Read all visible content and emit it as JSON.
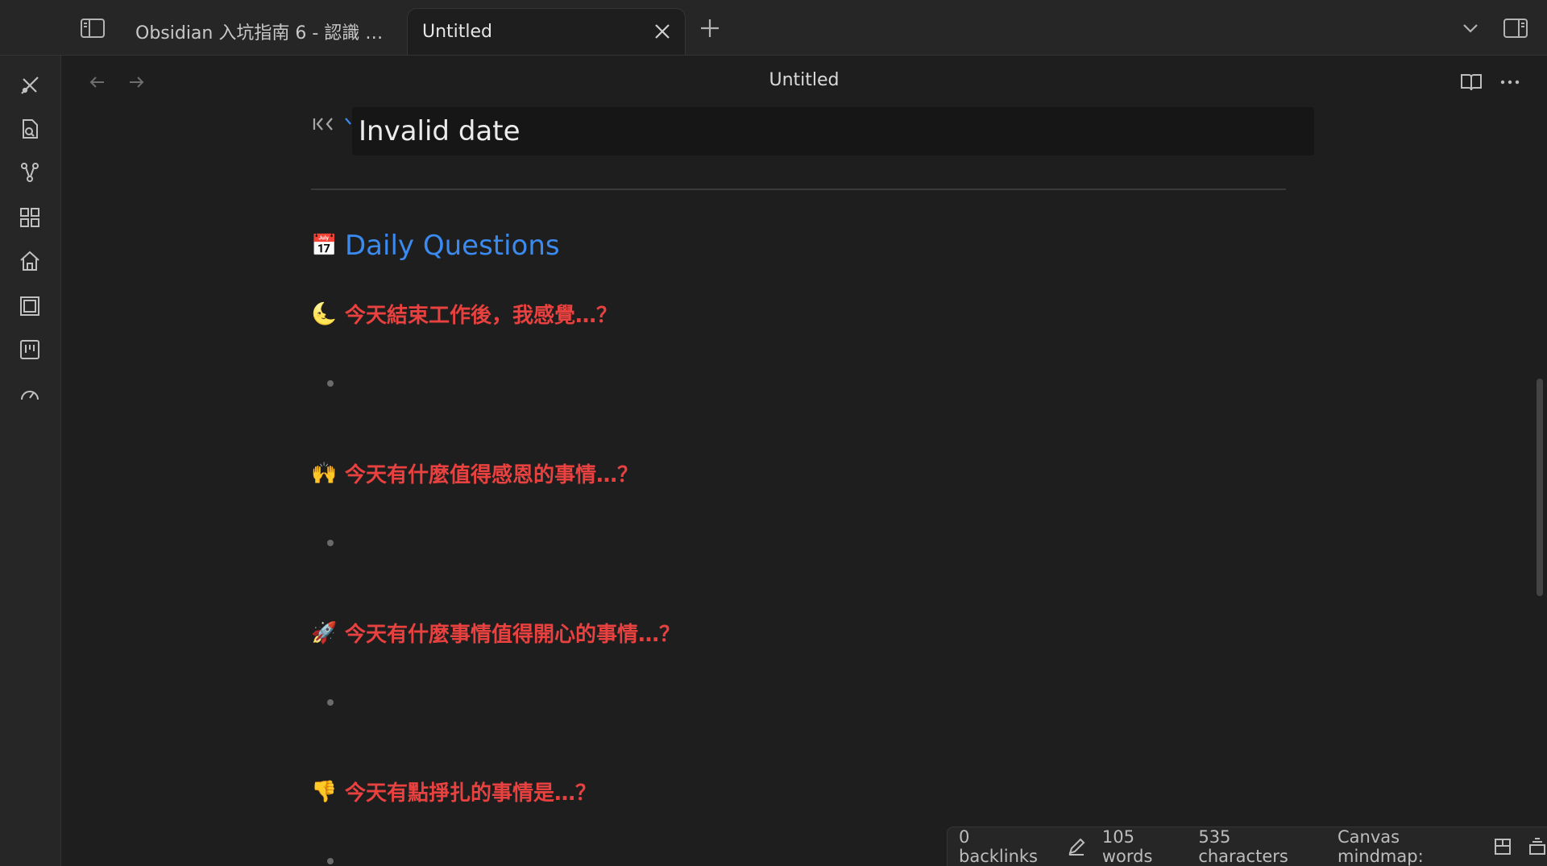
{
  "tabs": {
    "inactive_label": "Obsidian 入坑指南 6 - 認識 …",
    "active_label": "Untitled"
  },
  "icons": {
    "sidebar_toggle": "sidebar-left-icon",
    "new_tab": "plus-icon",
    "tab_list": "chevron-down-icon",
    "right_sidebar": "sidebar-right-icon",
    "close_tab": "close-icon"
  },
  "ribbon": {
    "items": [
      "pen-tool-icon",
      "file-search-icon",
      "graph-icon",
      "grid-icon",
      "home-icon",
      "layers-icon",
      "kanban-icon",
      "gauge-icon"
    ]
  },
  "view": {
    "title": "Untitled",
    "back_icon": "arrow-left-icon",
    "forward_icon": "arrow-right-icon",
    "reading_icon": "book-open-icon",
    "more_icon": "more-horizontal-icon"
  },
  "note": {
    "date_value": "Invalid date",
    "heading": "Daily Questions",
    "heading_emoji": "📅",
    "questions": [
      {
        "emoji": "🌜",
        "text": "今天結束工作後，我感覺…？"
      },
      {
        "emoji": "🙌",
        "text": "今天有什麼值得感恩的事情…？"
      },
      {
        "emoji": "🚀",
        "text": "今天有什麼事情值得開心的事情…？"
      },
      {
        "emoji": "👎",
        "text": "今天有點掙扎的事情是…？"
      }
    ]
  },
  "status": {
    "backlinks": "0 backlinks",
    "words": "105 words",
    "characters": "535 characters",
    "canvas": "Canvas mindmap:"
  },
  "colors": {
    "accent_blue": "#3b8af0",
    "question_red": "#e8413f",
    "background": "#1e1e1e"
  }
}
